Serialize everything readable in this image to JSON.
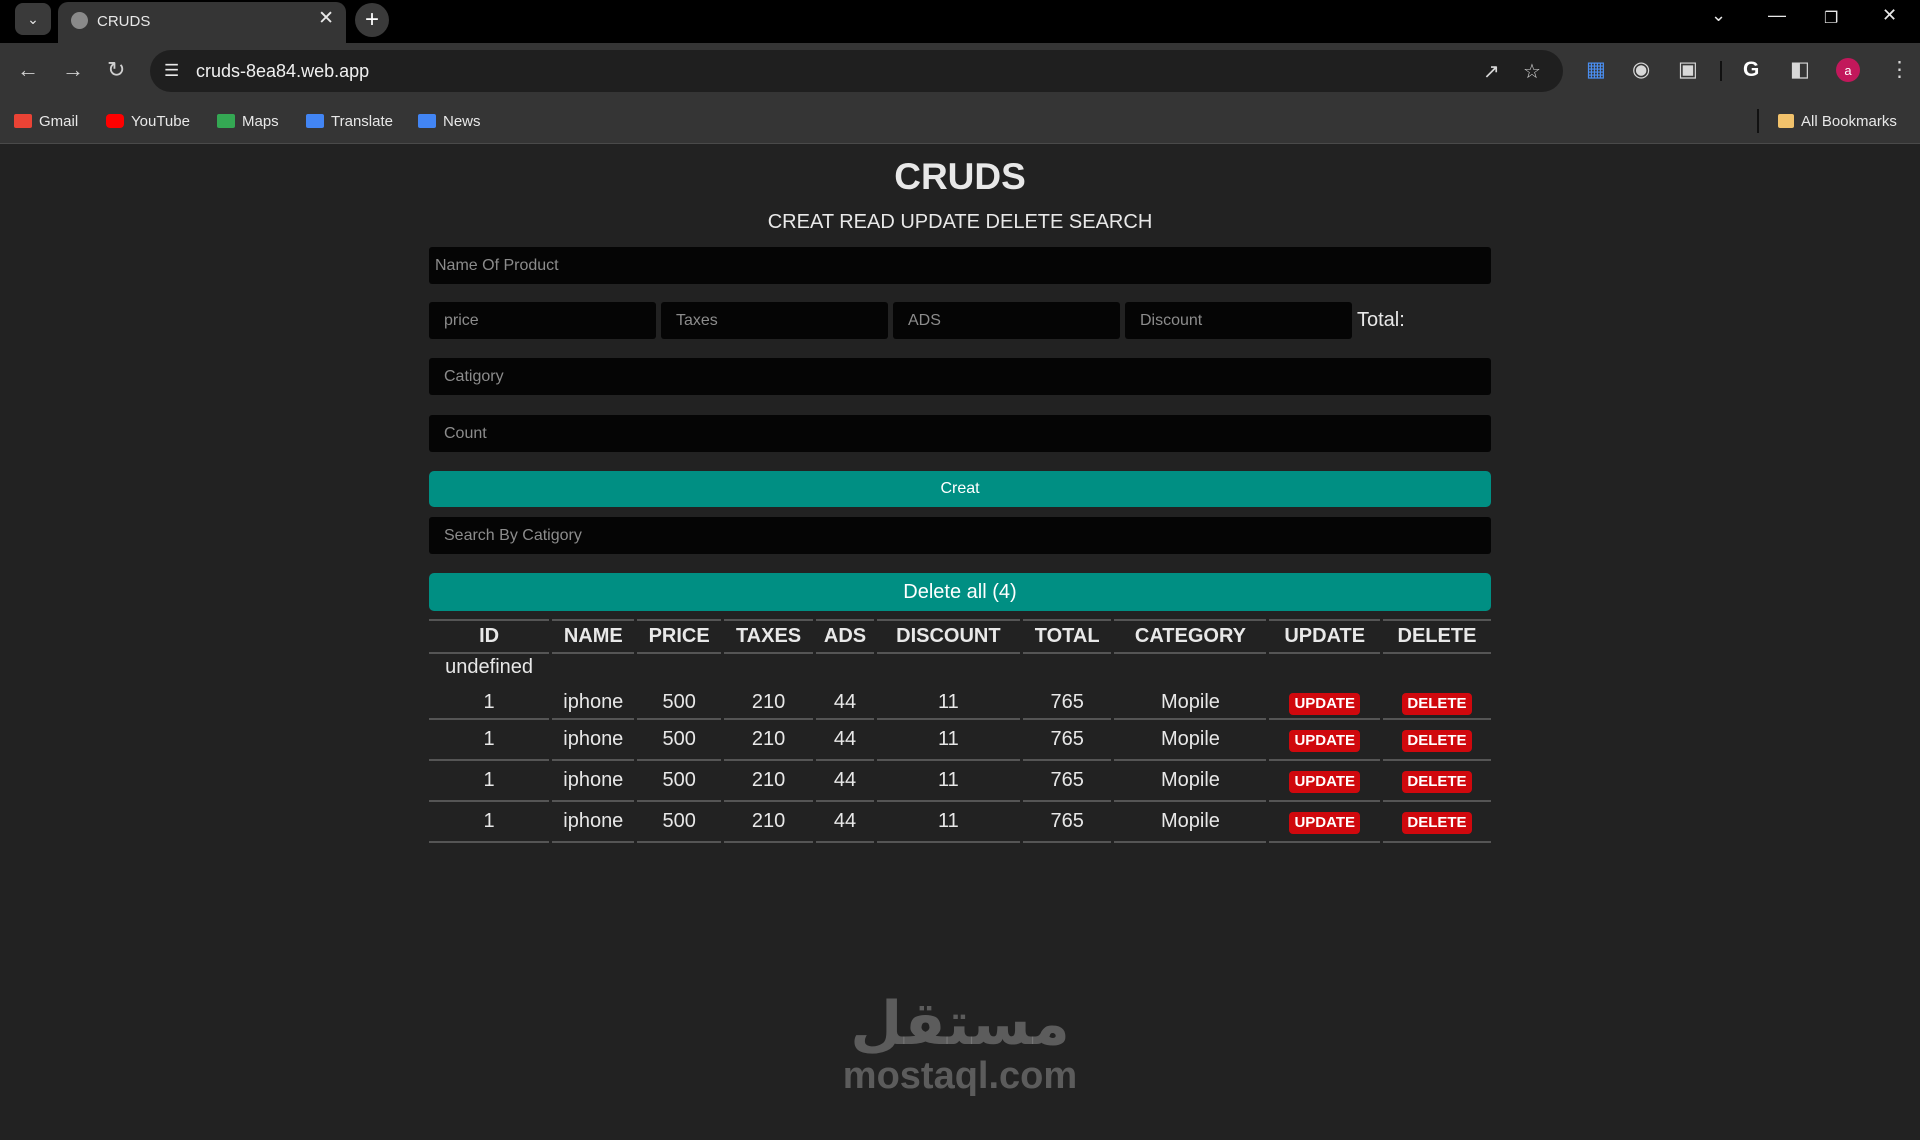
{
  "browser": {
    "tab_title": "CRUDS",
    "url": "cruds-8ea84.web.app",
    "avatar_letter": "a",
    "bookmarks": [
      {
        "label": "Gmail",
        "color": "#ea4335"
      },
      {
        "label": "YouTube",
        "color": "#ff0000"
      },
      {
        "label": "Maps",
        "color": "#34a853"
      },
      {
        "label": "Translate",
        "color": "#4285f4"
      },
      {
        "label": "News",
        "color": "#4285f4"
      }
    ],
    "all_bookmarks": "All Bookmarks"
  },
  "app": {
    "title": "CRUDS",
    "subtitle": "CREAT READ UPDATE DELETE SEARCH",
    "form": {
      "name_placeholder": "Name Of Product",
      "price_placeholder": "price",
      "taxes_placeholder": "Taxes",
      "ads_placeholder": "ADS",
      "discount_placeholder": "Discount",
      "total_label": "Total:",
      "category_placeholder": "Catigory",
      "count_placeholder": "Count",
      "create_label": "Creat",
      "search_placeholder": "Search By Catigory",
      "delete_all_label": "Delete all (4)"
    },
    "table": {
      "headers": [
        "ID",
        "NAME",
        "PRICE",
        "TAXES",
        "ADS",
        "DISCOUNT",
        "TOTAL",
        "CATEGORY",
        "UPDATE",
        "DELETE"
      ],
      "undefined_label": "undefined",
      "update_label": "UPDATE",
      "delete_label": "DELETE",
      "rows": [
        {
          "id": "1",
          "name": "iphone",
          "price": "500",
          "taxes": "210",
          "ads": "44",
          "discount": "11",
          "total": "765",
          "category": "Mopile"
        },
        {
          "id": "1",
          "name": "iphone",
          "price": "500",
          "taxes": "210",
          "ads": "44",
          "discount": "11",
          "total": "765",
          "category": "Mopile"
        },
        {
          "id": "1",
          "name": "iphone",
          "price": "500",
          "taxes": "210",
          "ads": "44",
          "discount": "11",
          "total": "765",
          "category": "Mopile"
        },
        {
          "id": "1",
          "name": "iphone",
          "price": "500",
          "taxes": "210",
          "ads": "44",
          "discount": "11",
          "total": "765",
          "category": "Mopile"
        }
      ]
    },
    "accent_color": "#008f83",
    "danger_color": "#d0080d"
  },
  "watermark": {
    "arabic": "مستقل",
    "latin": "mostaql.com"
  }
}
